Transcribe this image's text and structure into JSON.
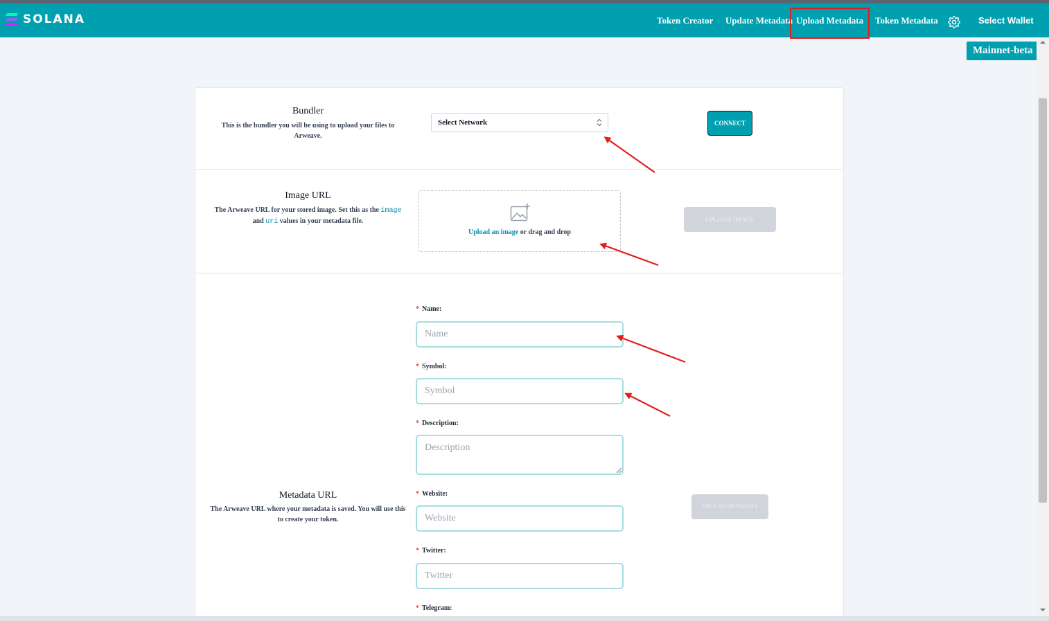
{
  "navbar": {
    "logo_text": "SOLANA",
    "items": [
      {
        "label": "Token Creator"
      },
      {
        "label": "Update Metadata"
      },
      {
        "label": "Upload Metadata"
      },
      {
        "label": "Token Metadata"
      }
    ],
    "settings_icon": "gear-icon",
    "wallet_label": "Select Wallet",
    "network_label": "Mainnet-beta",
    "accent_color": "#00a0b0",
    "highlight_color": "#e11d1d"
  },
  "bundler": {
    "title": "Bundler",
    "description": "This is the bundler you will be using to upload your files to Arweave.",
    "select_value": "Select Network",
    "connect_label": "CONNECT"
  },
  "image_url": {
    "title": "Image URL",
    "desc_part1": "The Arweave URL for your stored image. Set this as the",
    "code1": "image",
    "desc_part2": "and",
    "code2": "uri",
    "desc_part3": "values in your metadata file.",
    "upload_link": "Upload an image",
    "upload_rest": "or drag and drop",
    "upload_button": "UPLOAD IMAGE"
  },
  "metadata_url": {
    "title": "Metadata URL",
    "description": "The Arweave URL where your metadata is saved. You will use this to create your token.",
    "upload_button": "UPLOAD METADATA"
  },
  "form": {
    "required_mark": "*",
    "fields": [
      {
        "label": "Name:",
        "placeholder": "Name"
      },
      {
        "label": "Symbol:",
        "placeholder": "Symbol"
      },
      {
        "label": "Description:",
        "placeholder": "Description"
      },
      {
        "label": "Website:",
        "placeholder": "Website"
      },
      {
        "label": "Twitter:",
        "placeholder": "Twitter"
      },
      {
        "label": "Telegram:",
        "placeholder": ""
      }
    ]
  }
}
